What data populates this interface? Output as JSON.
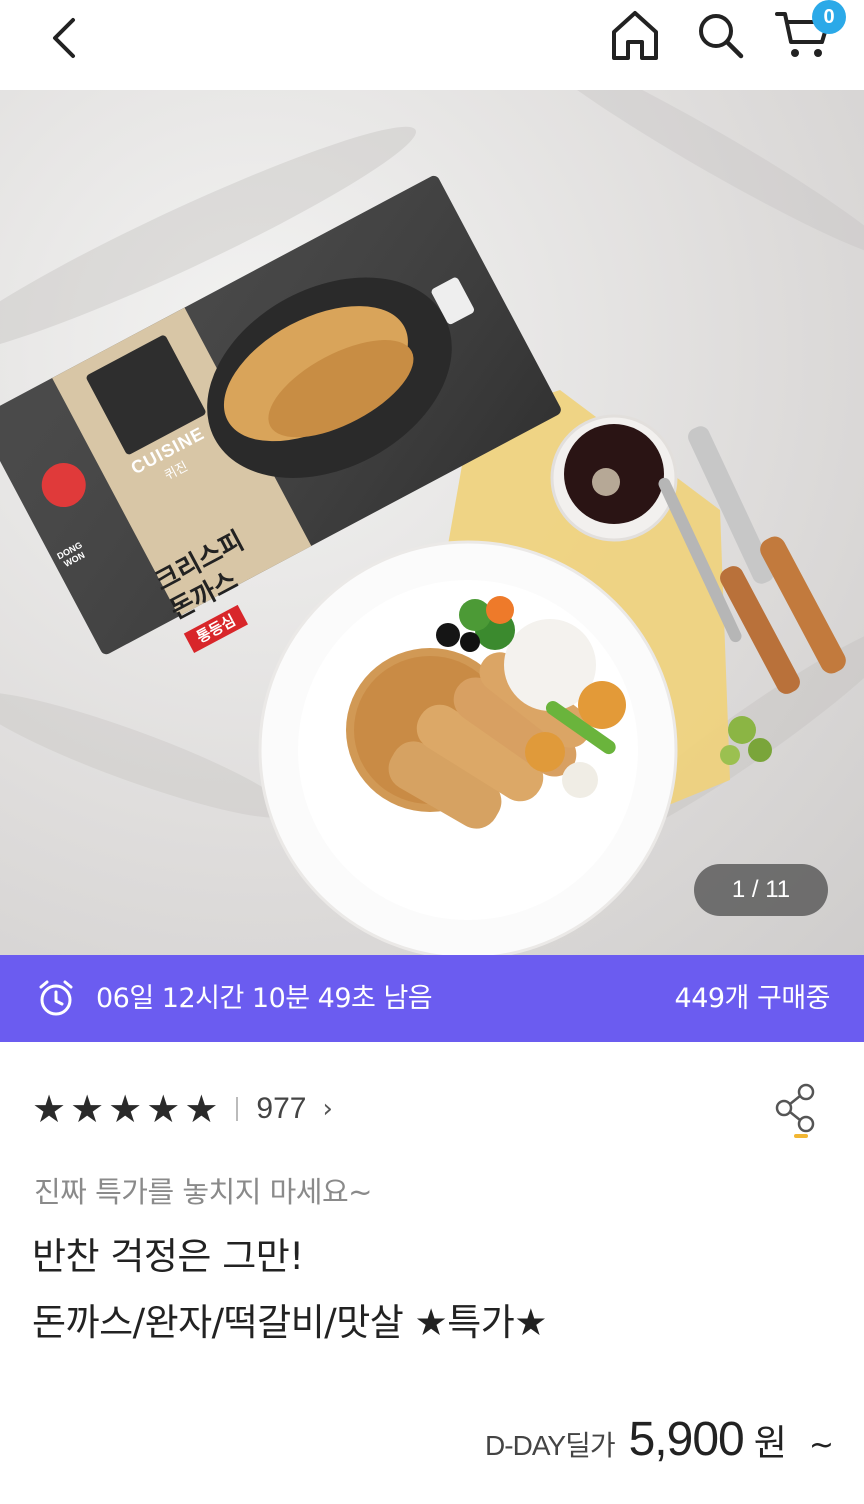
{
  "header": {
    "back_icon": "chevron-left-icon",
    "home_icon": "home-icon",
    "search_icon": "search-icon",
    "cart_icon": "cart-icon",
    "cart_count": "0",
    "accent": "#2ba9e8"
  },
  "gallery": {
    "counter": "1 / 11",
    "package": {
      "brand_badge": "DONG WON",
      "label_en": "CUISINE",
      "label_ko": "퀴진",
      "product_name_1": "크리스피",
      "product_name_2": "돈까스",
      "tag": "통등심"
    }
  },
  "timer": {
    "icon": "alarm-clock-icon",
    "text": "06일 12시간 10분 49초 남음",
    "buying": "449개 구매중",
    "color": "#6b5cf0"
  },
  "rating": {
    "stars": 5,
    "review_count": "977",
    "arrow": "›"
  },
  "share": {
    "icon": "share-icon"
  },
  "product": {
    "promo": "진짜 특가를 놓치지 마세요~",
    "title_line1": "반찬 걱정은 그만!",
    "title_line2": "돈까스/완자/떡갈비/맛살 ★특가★"
  },
  "price": {
    "label": "D-DAY딜가",
    "value": "5,900",
    "unit": "원",
    "suffix": "~"
  }
}
